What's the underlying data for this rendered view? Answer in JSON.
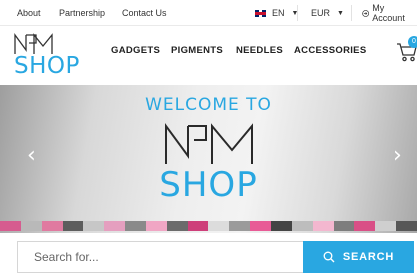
{
  "topbar": {
    "links": [
      "About",
      "Partnership",
      "Contact Us"
    ],
    "language": "EN",
    "currency": "EUR",
    "account": "My Account"
  },
  "logo": {
    "shop_text": "SHOP"
  },
  "nav": {
    "items": [
      "GADGETS",
      "PIGMENTS",
      "NEEDLES",
      "ACCESSORIES"
    ]
  },
  "cart": {
    "count": "0"
  },
  "hero": {
    "welcome": "WELCOME TO",
    "shop_text": "SHOP",
    "prev_arrow": "‹",
    "next_arrow": "›"
  },
  "search": {
    "placeholder": "Search for...",
    "button_label": "SEARCH"
  },
  "colors": {
    "accent": "#29a7e1",
    "stripe": [
      "#d65c8f",
      "#b9b9b9",
      "#e07aa0",
      "#5d5d5d",
      "#c7c7c7",
      "#e59fbf",
      "#8a8a8a",
      "#f0a6c4",
      "#6b6b6b",
      "#ce3f7a",
      "#dcdcdc",
      "#9b9b9b",
      "#e85b96",
      "#444444",
      "#bdbdbd",
      "#f3b7cf",
      "#7d7d7d",
      "#d94f86",
      "#cfcfcf",
      "#575757"
    ]
  }
}
